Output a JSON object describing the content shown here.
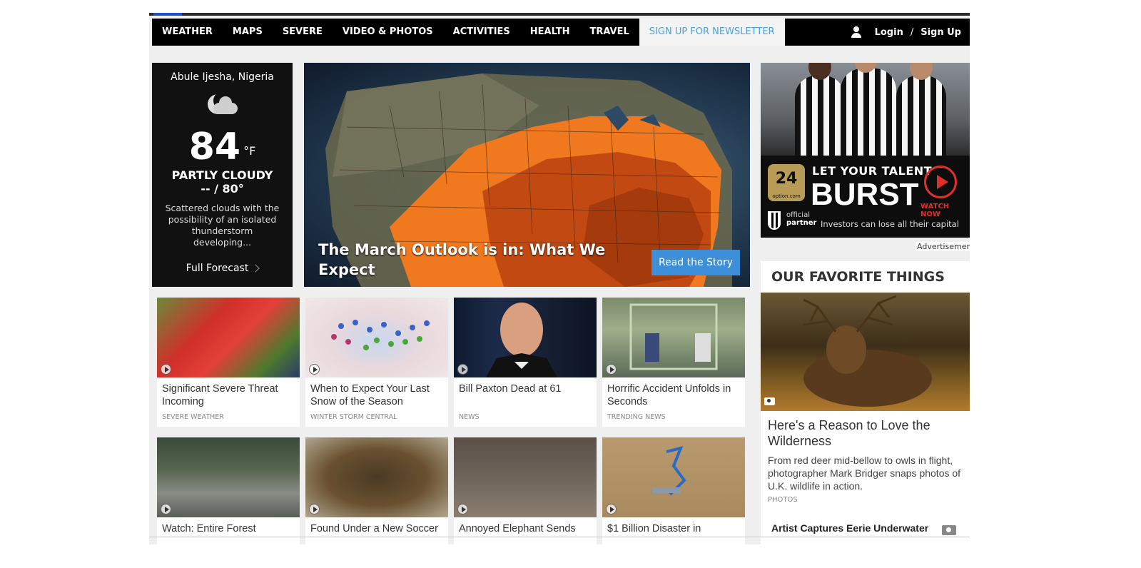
{
  "nav": {
    "items": [
      "WEATHER",
      "MAPS",
      "SEVERE",
      "VIDEO & PHOTOS",
      "ACTIVITIES",
      "HEALTH",
      "TRAVEL"
    ],
    "newsletter": "SIGN UP FOR NEWSLETTER",
    "login": "Login",
    "separator": "/",
    "signup": "Sign Up"
  },
  "weather": {
    "location": "Abule Ijesha, Nigeria",
    "icon": "partly-cloudy-night-icon",
    "temp": "84",
    "unit": "°F",
    "condition": "PARTLY CLOUDY",
    "hilo": "-- / 80°",
    "description": "Scattered clouds with the possibility of an isolated thunderstorm developing...",
    "full_forecast": "Full Forecast"
  },
  "hero": {
    "caption": "The March Outlook is in: What We Expect",
    "button": "Read the Story"
  },
  "ad": {
    "brand": "24",
    "brand_sub": "option.com",
    "line1": "LET YOUR TALENT",
    "line2": "BURST",
    "watch": "WATCH NOW",
    "partner_line1": "official",
    "partner_line2": "partner",
    "disclaimer": "Investors can lose all their capital",
    "label": "Advertisement"
  },
  "favorites": {
    "heading": "OUR FAVORITE THINGS",
    "title": "Here's a Reason to Love the Wilderness",
    "subtitle": "From red deer mid-bellow to owls in flight, photographer Mark Bridger snaps photos of U.K. wildlife in action.",
    "category": "PHOTOS",
    "next_title": "Artist Captures Eerie Underwater"
  },
  "tiles": [
    {
      "title": "Significant Severe Threat Incoming",
      "category": "SEVERE WEATHER"
    },
    {
      "title": "When to Expect Your Last Snow of the Season",
      "category": "WINTER STORM CENTRAL"
    },
    {
      "title": "Bill Paxton Dead at 61",
      "category": "NEWS"
    },
    {
      "title": "Horrific Accident Unfolds in Seconds",
      "category": "TRENDING NEWS"
    },
    {
      "title": "Watch: Entire Forest",
      "category": ""
    },
    {
      "title": "Found Under a New Soccer",
      "category": ""
    },
    {
      "title": "Annoyed Elephant Sends",
      "category": ""
    },
    {
      "title": "$1 Billion Disaster in",
      "category": ""
    }
  ],
  "colors": {
    "nav_bg": "#000000",
    "newsletter_text": "#44a3e0",
    "hero_button": "#3c8fd8",
    "ad_accent": "#e0302a"
  }
}
